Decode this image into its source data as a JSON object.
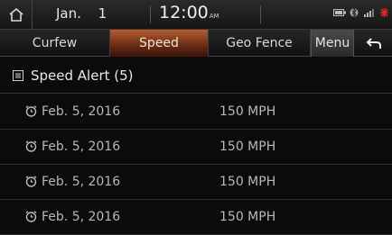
{
  "status_bar": {
    "month": "Jan.",
    "day": "1",
    "time": "12:00",
    "ampm": "AM"
  },
  "tabs": [
    {
      "label": "Curfew",
      "active": false
    },
    {
      "label": "Speed",
      "active": true
    },
    {
      "label": "Geo Fence",
      "active": false
    }
  ],
  "menu_label": "Menu",
  "list_header": {
    "title": "Speed Alert (5)",
    "icon": "list-icon"
  },
  "alerts": [
    {
      "date": "Feb. 5, 2016",
      "speed": "150 MPH"
    },
    {
      "date": "Feb. 5, 2016",
      "speed": "150 MPH"
    },
    {
      "date": "Feb. 5, 2016",
      "speed": "150 MPH"
    },
    {
      "date": "Feb. 5, 2016",
      "speed": "150 MPH"
    }
  ],
  "colors": {
    "active_tab": "#8a3b1b",
    "background": "#0b0b0b",
    "status_red": "#e0262b"
  }
}
